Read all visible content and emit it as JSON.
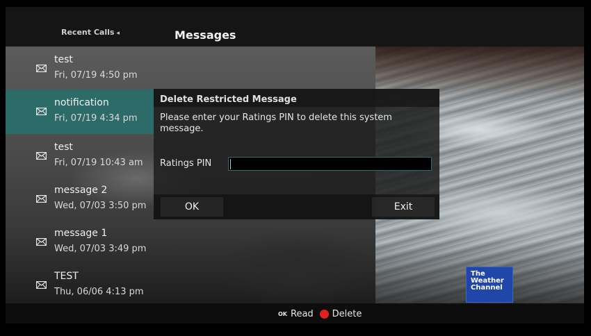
{
  "header": {
    "recent_calls_label": "Recent Calls",
    "recent_calls_arrow": "◂",
    "title": "Messages"
  },
  "messages": [
    {
      "title": "test",
      "date": "Fri, 07/19 4:50 pm",
      "selected": false
    },
    {
      "title": "notification",
      "date": "Fri, 07/19 4:34 pm",
      "selected": true
    },
    {
      "title": "test",
      "date": "Fri, 07/19 10:43 am",
      "selected": false
    },
    {
      "title": "message 2",
      "date": "Wed, 07/03 3:50 pm",
      "selected": false
    },
    {
      "title": "message 1",
      "date": "Wed, 07/03 3:49 pm",
      "selected": false
    },
    {
      "title": "TEST",
      "date": "Thu, 06/06 4:13 pm",
      "selected": false
    }
  ],
  "dialog": {
    "title": "Delete Restricted Message",
    "body": "Please enter your Ratings PIN to delete this system message.",
    "pin_label": "Ratings PIN",
    "pin_value": "",
    "ok_label": "OK",
    "exit_label": "Exit"
  },
  "logo": {
    "line1": "The",
    "line2": "Weather",
    "line3": "Channel"
  },
  "legend": {
    "ok_glyph": "OK",
    "read_label": "Read",
    "delete_label": "Delete"
  },
  "colors": {
    "selected": "#2d6b68",
    "delete_dot": "#e02020",
    "logo_bg": "#1f46a8"
  },
  "icons": [
    "envelope-icon"
  ]
}
